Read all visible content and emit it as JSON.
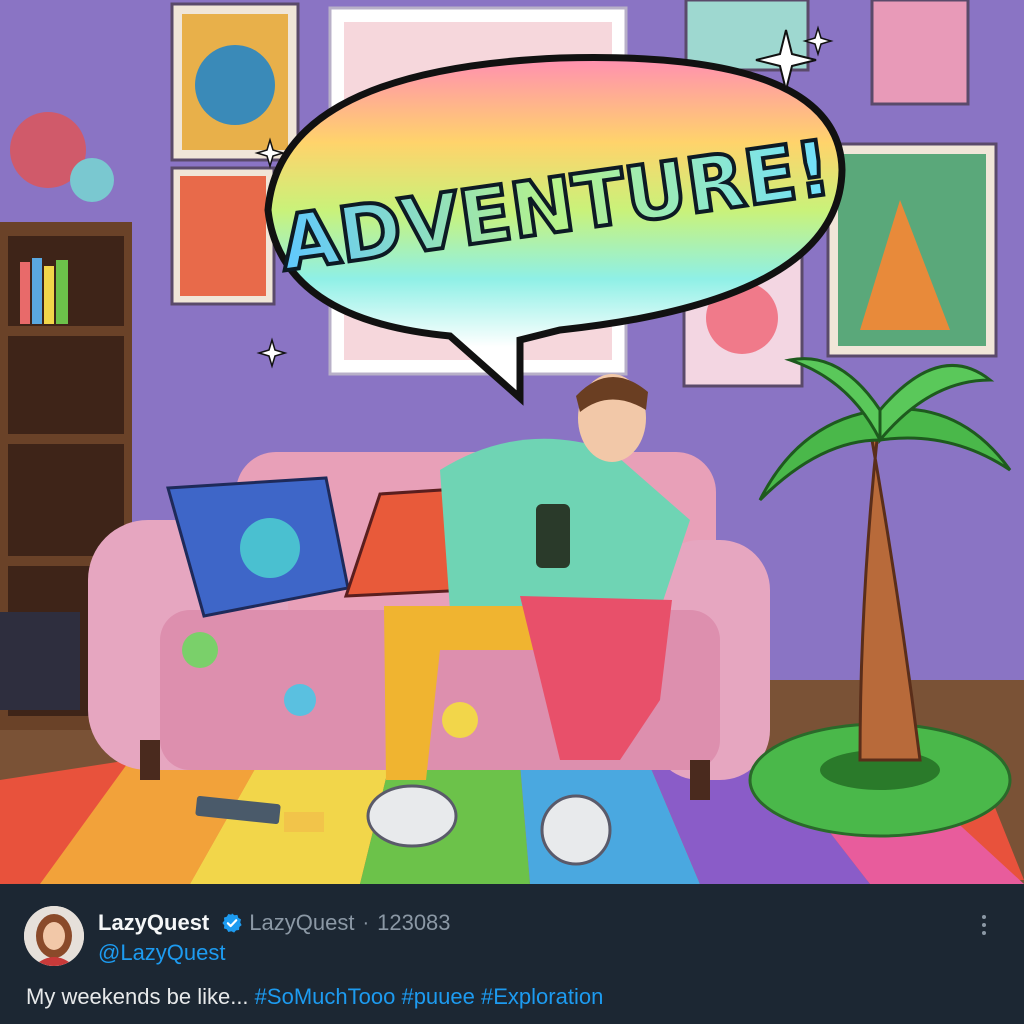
{
  "illustration": {
    "bubble_text": "ADVENTURE!",
    "scene_elements": [
      "room-wall",
      "posters",
      "bookshelf",
      "sofa",
      "person-with-phone",
      "inflatable-palm-tree",
      "rainbow-rug"
    ]
  },
  "post": {
    "display_name": "LazyQuest",
    "handle_inline": "LazyQuest",
    "separator": "·",
    "stamp": "123083",
    "handle": "@LazyQuest",
    "text_plain": "My weekends be like... ",
    "tags": [
      "#SoMuchTooo",
      "#puuee",
      "#Exploration"
    ],
    "verified_icon": "verified-badge-icon",
    "more_icon": "more-vertical-icon"
  },
  "colors": {
    "background": "#1c2733",
    "link": "#1d9bf0",
    "muted": "#8b98a5",
    "wall": "#8a74c4"
  }
}
